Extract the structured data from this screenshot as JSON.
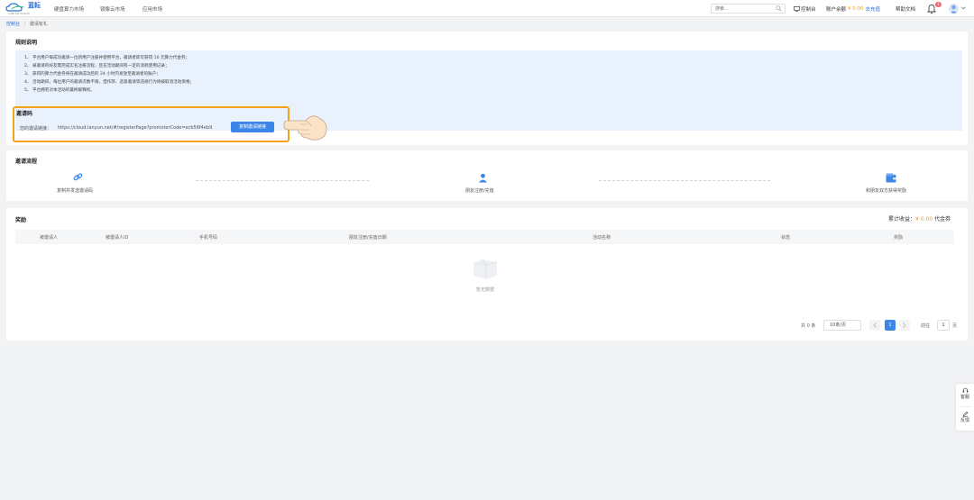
{
  "nav": {
    "logo_text": "蓝耘",
    "logo_sub": "LANYUN CLOUD",
    "links": [
      "硬盘算力市场",
      "镜像云市场",
      "应用市场"
    ],
    "search_placeholder": "搜索...",
    "console": "控制台",
    "balance_label": "账户余额",
    "balance_value": "¥ 0.00",
    "recharge": "去充值",
    "docs": "帮助文档",
    "bell_count": "1"
  },
  "breadcrumb": {
    "home": "控制台",
    "separator": "/",
    "current": "邀请有礼"
  },
  "rules": {
    "title": "规则说明",
    "lines": [
      "1、 平台用户每成功邀请一位新用户注册并使用平台，邀请者即可获得 10 元算力代金券；",
      "2、 被邀请的好友需完成实名注册流程，且在活动期间有一定的消耗使用记录；",
      "3、 获得的算力代金券将在邀请成功后的 24 小时内发放至邀请者的账户；",
      "4、 活动期间，每位用户的邀请次数不限，但作弊、恶意邀请等违规行为将被取消活动资格；",
      "5、 平台拥有对本活动的最终解释权。"
    ]
  },
  "invite": {
    "title": "邀请码",
    "label": "您的邀请链接：",
    "link": "https://cloud.lanyun.net/#/registerPage?promoterCode=ecb56f4eb9",
    "copy_button": "复制邀请链接"
  },
  "flow": {
    "title": "邀请流程",
    "steps": [
      {
        "label": "复制并发送邀请码",
        "icon": "link-icon"
      },
      {
        "label": "朋友注册/充值",
        "icon": "user-icon"
      },
      {
        "label": "和朋友双方获得奖励",
        "icon": "wallet-icon"
      }
    ]
  },
  "reward": {
    "title": "奖励",
    "earnings_label": "累计收益：",
    "earnings_value": "¥ 0.00",
    "earnings_unit": " 代金券",
    "columns": [
      "被邀请人",
      "被邀请人ID",
      "手机号码",
      "朋友注册/充值日期",
      "活动名称",
      "状态",
      "奖励"
    ],
    "empty_text": "暂无数据"
  },
  "pager": {
    "total": "共 0 条",
    "page_size": "10条/页",
    "current_page": "1",
    "goto_label": "前往",
    "goto_value": "1",
    "page_unit": "页"
  },
  "float_panel": {
    "service": "客服",
    "feedback": "反馈"
  },
  "colors": {
    "accent": "#3b86e8",
    "highlight": "#f4a21a",
    "money": "#f39c12"
  }
}
